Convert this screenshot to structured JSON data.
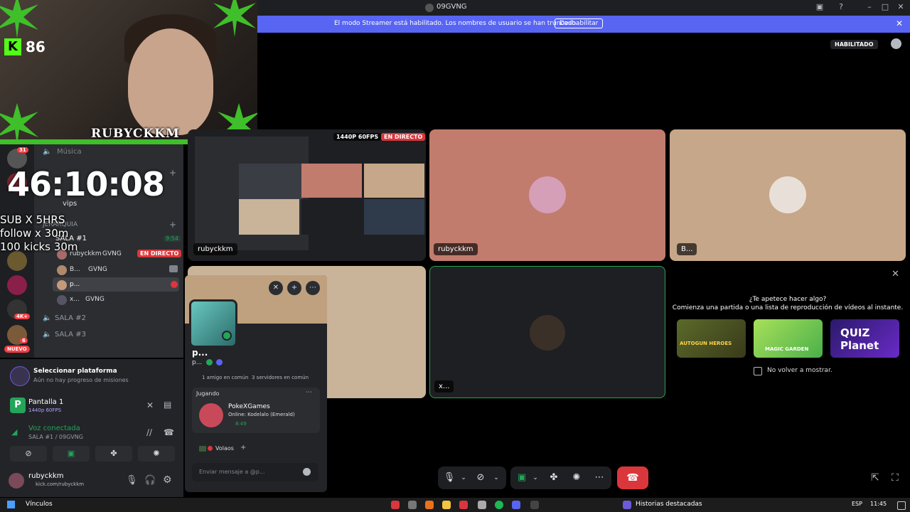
{
  "window": {
    "title": "09GVNG"
  },
  "banner": {
    "message": "El modo Streamer está habilitado. Los nombres de usuario se han truncado.",
    "button": "Deshabilitar"
  },
  "status": {
    "habilitado": "HABILITADO"
  },
  "webcam": {
    "viewers": "86",
    "kick_letter": "K",
    "nickname": "RUBYCKKM"
  },
  "overlay": {
    "timer": "46:10:08",
    "lines": [
      "SUB X 5HRS",
      "follow x 30m",
      "100 kicks 30m"
    ]
  },
  "rail": {
    "badges": [
      "31",
      "4K+",
      "6"
    ],
    "new_label": "NUEVO"
  },
  "sidebar": {
    "channel_musica": "Música",
    "channel_vips": "vips",
    "category": "JERARQUIA",
    "voice_channel": "SALA #1",
    "voice_time": "9:54",
    "members": [
      {
        "name": "rubyckkm",
        "tag": "GVNG",
        "live": "EN DIRECTO"
      },
      {
        "name": "B...",
        "tag": "GVNG"
      },
      {
        "name": "p...",
        "tag": ""
      },
      {
        "name": "x...",
        "tag": "GVNG"
      }
    ],
    "sala2": "SALA #2",
    "sala3": "SALA #3"
  },
  "quest": {
    "title": "Seleccionar plataforma",
    "subtitle": "Aún no hay progreso de misiones"
  },
  "stream": {
    "screen": "Pantalla 1",
    "quality": "1440p 60FPS"
  },
  "voice": {
    "status": "Voz conectada",
    "channel": "SALA #1 / 09GVNG"
  },
  "user": {
    "name": "rubyckkm",
    "status": "kick.com/rubyckkm"
  },
  "popup": {
    "display_name": "p...",
    "username": "p...",
    "mutuals": "1 amigo en común",
    "servers": "3 servidores en común",
    "section": "Jugando",
    "game_title": "PokeXGames",
    "game_detail": "Online: Kodelalo (Emerald)",
    "game_time": "8:49",
    "role": "Volaos",
    "message_placeholder": "Enviar mensaje a @p..."
  },
  "grid": {
    "screen_badge": "1440P 60FPS",
    "live_badge": "EN DIRECTO",
    "tile_labels": [
      "rubyckkm",
      "rubyckkm",
      "B...",
      "x..."
    ]
  },
  "activity": {
    "line1": "¿Te apetece hacer algo?",
    "line2": "Comienza una partida o una lista de reproducción de vídeos al instante.",
    "games": [
      "AUTOGUN HEROES",
      "MAGIC GARDEN",
      "QUIZ Planet"
    ],
    "checkbox_label": "No volver a mostrar."
  },
  "taskbar": {
    "links": "Vínculos",
    "stories": "Historias destacadas",
    "lang": "ESP",
    "clock": "11:45"
  },
  "colors": {
    "accent": "#5865f2",
    "live": "#da373c",
    "green": "#23a55a",
    "kick": "#53fc18",
    "hangup": "#da373c"
  }
}
